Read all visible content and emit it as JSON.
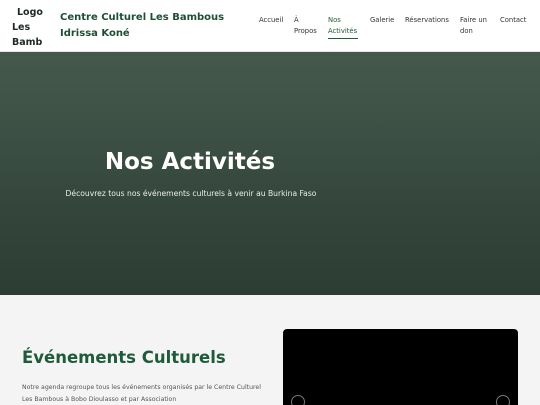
{
  "header": {
    "logo_alt_line1": "Logo",
    "logo_alt_line2": "Les",
    "logo_alt_line3": "Bamb",
    "site_title": "Centre Culturel Les Bambous Idrissa Koné",
    "nav": {
      "accueil": "Accueil",
      "a_propos": "À Propos",
      "activites": "Nos Activités",
      "galerie": "Galerie",
      "reservations": "Réservations",
      "faire_un_don": "Faire un don",
      "contact": "Contact"
    },
    "active_nav": "activites"
  },
  "hero": {
    "title": "Nos Activités",
    "subtitle": "Découvrez tous nos événements culturels à venir au Burkina Faso"
  },
  "section": {
    "title": "Événements Culturels",
    "text": "Notre agenda regroupe tous les événements organisés par le Centre Culturel Les Bambous à Bobo Dioulasso et par Association"
  },
  "colors": {
    "brand_green": "#1f5a3a",
    "hero_dark": "#2c3d33"
  }
}
